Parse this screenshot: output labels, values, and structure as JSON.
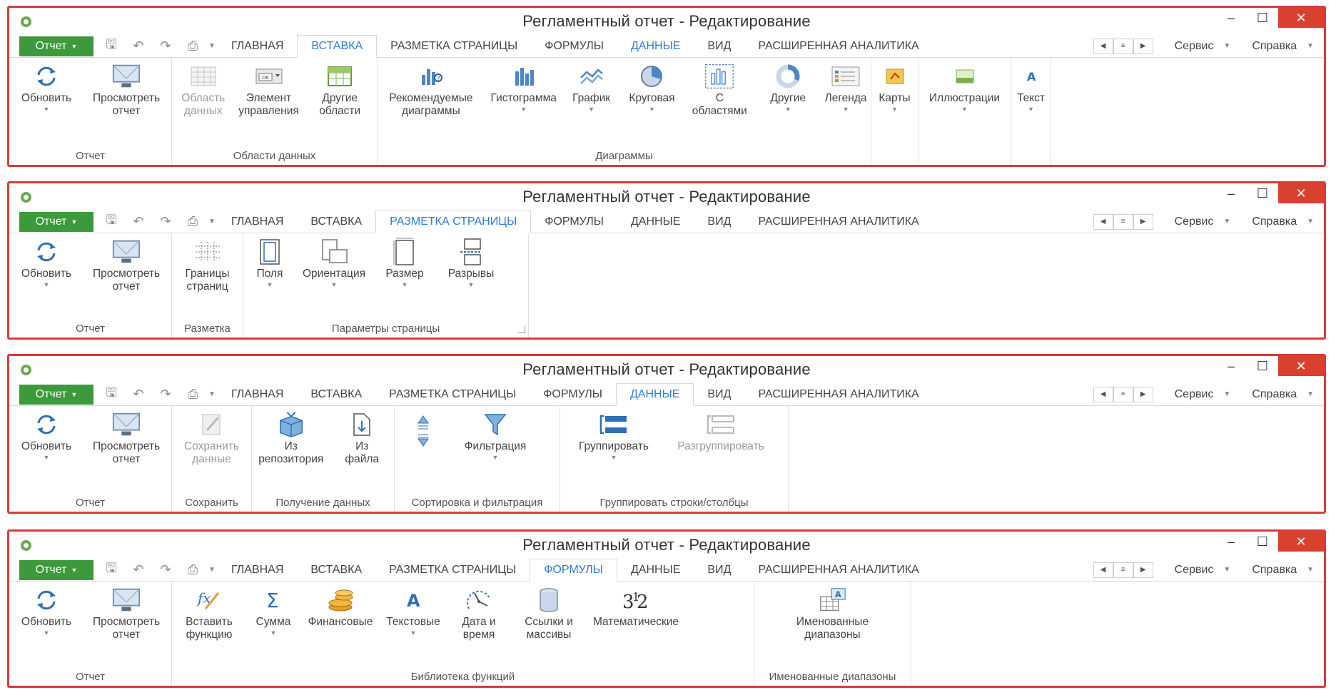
{
  "colors": {
    "frame": "#d93a3a",
    "file_button": "#3c9a3c",
    "active_tab": "#2e7bd6",
    "close": "#d9402e"
  },
  "window": {
    "title": "Регламентный отчет - Редактирование",
    "minimize": "–",
    "maximize": "☐",
    "close": "✕"
  },
  "file_button": "Отчет",
  "tabs": {
    "home": "ГЛАВНАЯ",
    "insert": "ВСТАВКА",
    "layout": "РАЗМЕТКА СТРАНИЦЫ",
    "formulas": "ФОРМУЛЫ",
    "data": "ДАННЫЕ",
    "view": "ВИД",
    "analytics": "РАСШИРЕННАЯ АНАЛИТИКА"
  },
  "menu_right": {
    "service": "Сервис",
    "help": "Справка"
  },
  "common": {
    "refresh": "Обновить",
    "view_report": "Просмотреть\nотчет",
    "group_report": "Отчет"
  },
  "panel1": {
    "btn_data_area": "Область\nданных",
    "btn_control": "Элемент\nуправления",
    "btn_other_areas": "Другие\nобласти",
    "group_data_areas": "Области данных",
    "btn_recommended": "Рекомендуемые\nдиаграммы",
    "btn_histogram": "Гистограмма",
    "btn_line": "График",
    "btn_pie": "Круговая",
    "btn_area": "С\nобластями",
    "btn_other": "Другие",
    "btn_legend": "Легенда",
    "group_charts": "Диаграммы",
    "btn_maps": "Карты",
    "btn_illustrations": "Иллюстрации",
    "btn_text": "Текст"
  },
  "panel2": {
    "btn_borders": "Границы\nстраниц",
    "group_markup": "Разметка",
    "btn_margins": "Поля",
    "btn_orientation": "Ориентация",
    "btn_size": "Размер",
    "btn_breaks": "Разрывы",
    "group_page_params": "Параметры страницы"
  },
  "panel3": {
    "btn_save_data": "Сохранить\nданные",
    "group_save": "Сохранить",
    "btn_from_repo": "Из\nрепозитория",
    "btn_from_file": "Из\nфайла",
    "group_get_data": "Получение данных",
    "btn_filter": "Фильтрация",
    "group_sort_filter": "Сортировка и фильтрация",
    "btn_group": "Группировать",
    "btn_ungroup": "Разгруппировать",
    "group_grouping": "Группировать строки/столбцы"
  },
  "panel4": {
    "btn_insert_func": "Вставить\nфункцию",
    "btn_sum": "Сумма",
    "btn_financial": "Финансовые",
    "btn_text_f": "Текстовые",
    "btn_datetime": "Дата и\nвремя",
    "btn_refs": "Ссылки и\nмассивы",
    "btn_math": "Математические",
    "group_func_lib": "Библиотека функций",
    "btn_named": "Именованные\nдиапазоны",
    "group_named": "Именованные диапазоны"
  }
}
